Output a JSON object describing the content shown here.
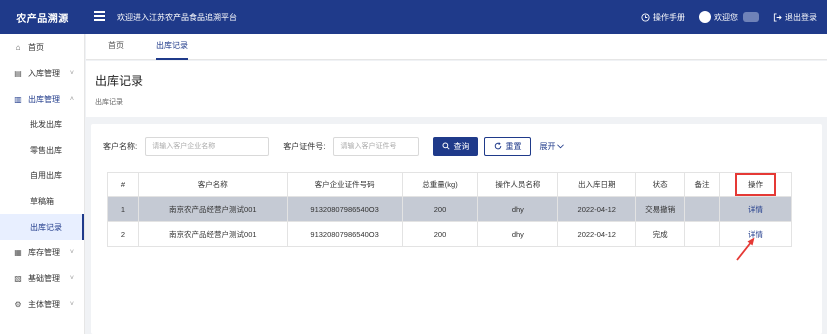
{
  "app": {
    "logo": "农产品溯源",
    "welcome": "欢迎进入江苏农产品食品追溯平台",
    "manual": "操作手册",
    "user_greeting": "欢迎您",
    "logout": "退出登录"
  },
  "sidebar": {
    "items": [
      {
        "label": "首页",
        "icon": "home-icon"
      },
      {
        "label": "入库管理",
        "icon": "inbound-icon",
        "chevron": "˅"
      },
      {
        "label": "出库管理",
        "icon": "outbound-icon",
        "chevron": "˄"
      },
      {
        "label": "库存管理",
        "icon": "inventory-icon",
        "chevron": "˅"
      },
      {
        "label": "基础管理",
        "icon": "base-icon",
        "chevron": "˅"
      },
      {
        "label": "主体管理",
        "icon": "subject-icon",
        "chevron": "˅"
      }
    ],
    "sub_items": [
      "批发出库",
      "零售出库",
      "自用出库",
      "草稿箱",
      "出库记录"
    ]
  },
  "tabs": {
    "home": "首页",
    "active": "出库记录"
  },
  "page": {
    "title": "出库记录",
    "breadcrumb": "出库记录"
  },
  "filter": {
    "customer_name_label": "客户名称:",
    "customer_name_placeholder": "请输入客户企业名称",
    "license_label": "客户证件号:",
    "license_placeholder": "请输入客户证件号",
    "search_button": "查询",
    "reset_button": "重置",
    "expand": "展开"
  },
  "table": {
    "headers": [
      "#",
      "客户名称",
      "客户企业证件号码",
      "总重量(kg)",
      "操作人员名称",
      "出入库日期",
      "状态",
      "备注",
      "操作"
    ],
    "rows": [
      {
        "no": "1",
        "name": "南京农产品经营户测试001",
        "license": "91320807986540O3",
        "weight": "200",
        "operator": "dhy",
        "date": "2022-04-12",
        "status": "交易撤销",
        "remark": "",
        "action": "详情"
      },
      {
        "no": "2",
        "name": "南京农产品经营户测试001",
        "license": "91320807986540O3",
        "weight": "200",
        "operator": "dhy",
        "date": "2022-04-12",
        "status": "完成",
        "remark": "",
        "action": "详情"
      }
    ]
  },
  "colors": {
    "primary": "#1f3a8a",
    "highlight_box": "#e53935",
    "selected_row": "#c5cad4"
  }
}
